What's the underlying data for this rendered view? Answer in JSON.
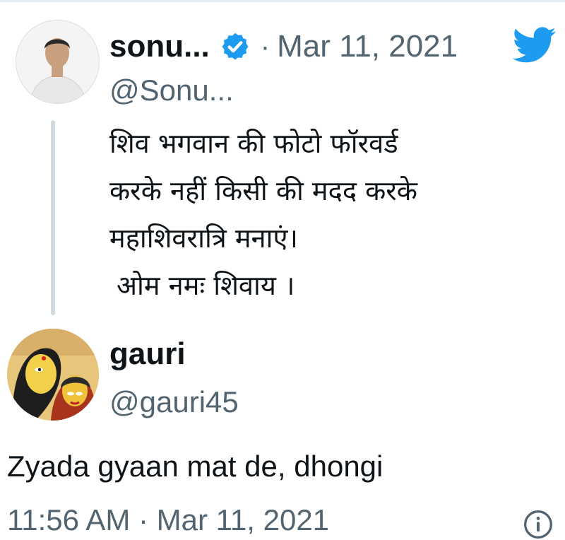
{
  "original_tweet": {
    "display_name": "sonu...",
    "handle": "@Sonu...",
    "separator": "·",
    "date": "Mar 11, 2021",
    "verified": true,
    "text_lines": [
      "शिव भगवान की फोटो फॉरवर्ड",
      "करके नहीं किसी की मदद करके",
      "महाशिवरात्रि मनाएं।",
      "ओम नमः शिवाय ।"
    ]
  },
  "reply_tweet": {
    "display_name": "gauri",
    "handle": "@gauri45",
    "text": "Zyada gyaan mat de, dhongi",
    "timestamp": "11:56 AM · Mar 11, 2021"
  },
  "icons": {
    "verified": "verified-badge-icon",
    "brand": "twitter-bird-icon",
    "info": "info-icon"
  },
  "colors": {
    "twitter_blue": "#1d9bf0",
    "text_primary": "#0f1419",
    "text_secondary": "#536471",
    "thread_line": "#cfd9de"
  }
}
